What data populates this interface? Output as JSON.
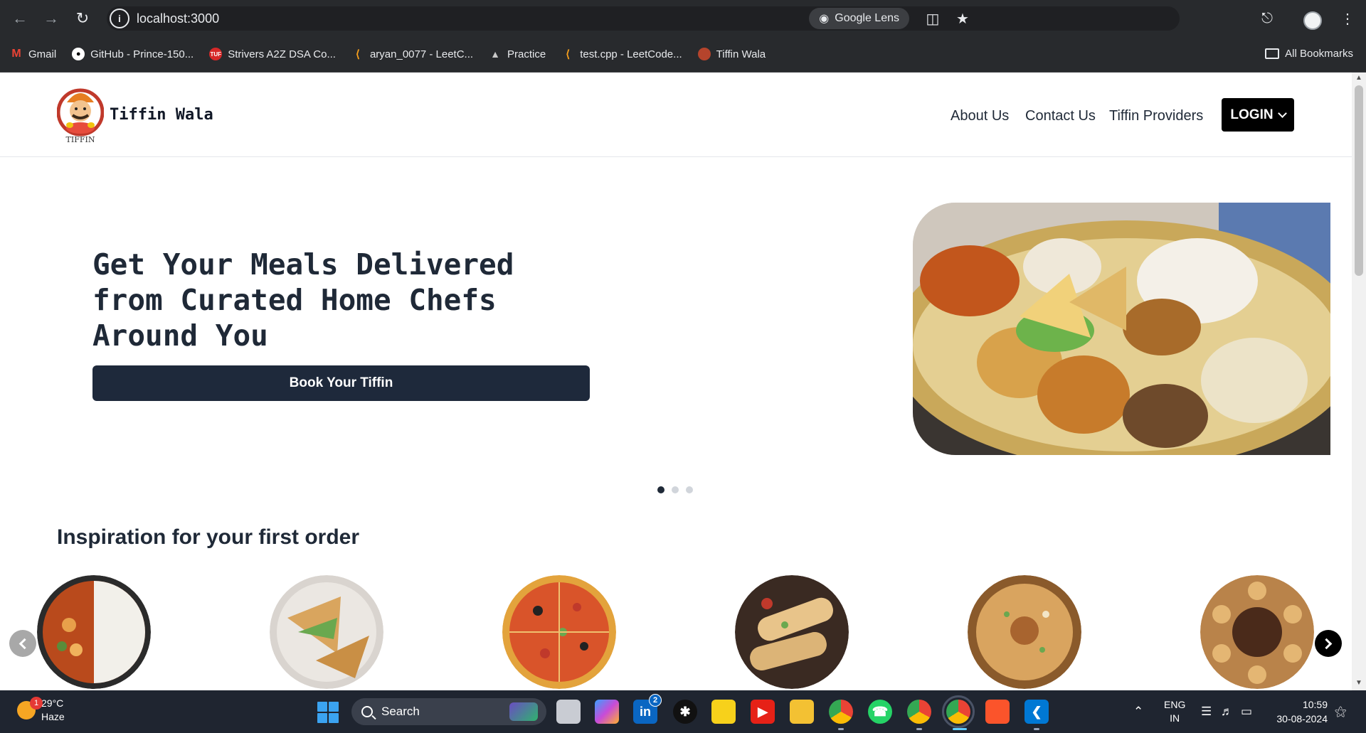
{
  "browser": {
    "url": "localhost:3000",
    "lens_label": "Google Lens",
    "bookmarks": [
      {
        "label": "Gmail",
        "icon": "gmail-icon",
        "color": "#ea4335"
      },
      {
        "label": "GitHub - Prince-150...",
        "icon": "github-icon",
        "color": "#ffffff"
      },
      {
        "label": "Strivers A2Z DSA Co...",
        "icon": "tuf-icon",
        "color": "#d62828"
      },
      {
        "label": "aryan_0077 - LeetC...",
        "icon": "leetcode-icon",
        "color": "#f89f1b"
      },
      {
        "label": "Practice",
        "icon": "rocket-icon",
        "color": "#c9c9c9"
      },
      {
        "label": "test.cpp - LeetCode...",
        "icon": "leetcode-icon",
        "color": "#f89f1b"
      },
      {
        "label": "Tiffin Wala",
        "icon": "tiffin-favicon",
        "color": "#b5442c"
      }
    ],
    "all_bookmarks_label": "All Bookmarks"
  },
  "header": {
    "brand": "Tiffin Wala",
    "logo_caption": "TIFFIN",
    "nav": [
      "About Us",
      "Contact Us",
      "Tiffin Providers"
    ],
    "login_label": "LOGIN"
  },
  "hero": {
    "title": "Get Your Meals Delivered from Curated Home Chefs Around You",
    "cta_label": "Book Your Tiffin",
    "slides_total": 3,
    "active_slide": 1
  },
  "inspiration": {
    "title": "Inspiration for your first order"
  },
  "taskbar": {
    "weather_temp": "29°C",
    "weather_desc": "Haze",
    "weather_badge": "1",
    "search_label": "Search",
    "linkedin_badge": "2",
    "lang_line1": "ENG",
    "lang_line2": "IN",
    "time": "10:59",
    "date": "30-08-2024"
  },
  "colors": {
    "chrome_bg": "#282a2d",
    "login_bg": "#000000",
    "cta_bg": "#1e293b",
    "taskbar_bg": "#1f2530"
  }
}
